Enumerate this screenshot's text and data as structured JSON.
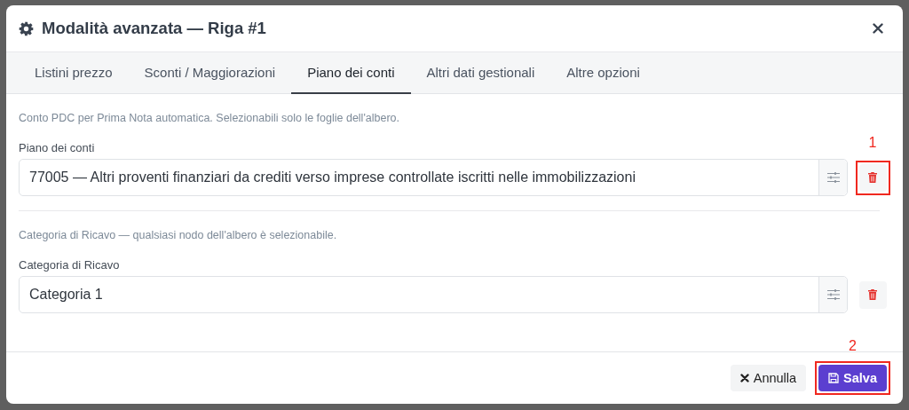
{
  "dialog": {
    "title": "Modalità avanzata — Riga #1"
  },
  "tabs": [
    {
      "label": "Listini prezzo",
      "selected": false
    },
    {
      "label": "Sconti / Maggiorazioni",
      "selected": false
    },
    {
      "label": "Piano dei conti",
      "selected": true
    },
    {
      "label": "Altri dati gestionali",
      "selected": false
    },
    {
      "label": "Altre opzioni",
      "selected": false
    }
  ],
  "sections": [
    {
      "hint": "Conto PDC per Prima Nota automatica. Selezionabili solo le foglie dell'albero.",
      "label": "Piano dei conti",
      "value": "77005 — Altri proventi finanziari da crediti verso imprese controllate iscritti nelle immobilizzazioni",
      "callout": "1"
    },
    {
      "hint": "Categoria di Ricavo — qualsiasi nodo dell'albero è selezionabile.",
      "label": "Categoria di Ricavo",
      "value": "Categoria 1"
    }
  ],
  "buttons": [
    {
      "label": "Annulla",
      "kind": "secondary"
    },
    {
      "label": "Salva",
      "kind": "primary",
      "callout": "2"
    }
  ]
}
